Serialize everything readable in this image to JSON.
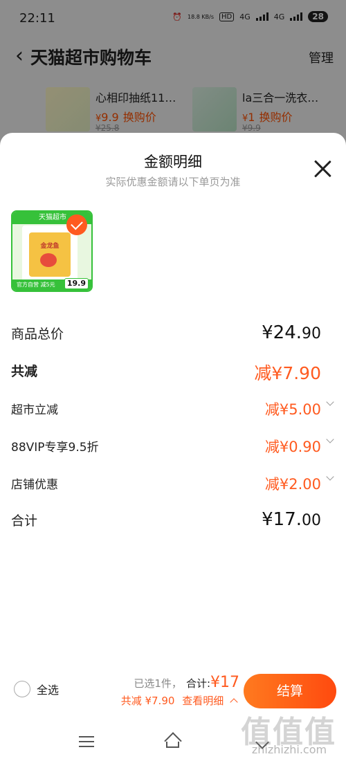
{
  "status_bar": {
    "time": "22:11",
    "net_speed": "18.8 KB/s",
    "hd": "HD",
    "net_type_1": "4G",
    "net_type_2": "4G",
    "battery": "28"
  },
  "header": {
    "back_icon": "chevron-left-icon",
    "title": "天猫超市购物车",
    "manage": "管理"
  },
  "promo_items": [
    {
      "name": "心相印抽纸11…",
      "price": "9.9",
      "tag": "换购价",
      "old_price": "¥25.8"
    },
    {
      "name": "la三合一洗衣…",
      "price": "1",
      "tag": "换购价",
      "old_price": "¥9.9"
    }
  ],
  "sheet": {
    "title": "金额明细",
    "subtitle": "实际优惠金额请以下单页为准",
    "close_icon": "close-icon"
  },
  "product": {
    "banner": "天猫超市",
    "name": "金龙鱼",
    "footer": "官方自营 减5元",
    "price_badge": "19.9",
    "selected": true
  },
  "breakdown": {
    "total_label": "商品总价",
    "total_yen": "¥24.",
    "total_dec": "90",
    "reduce_label": "共减",
    "reduce_value": "减¥7.90",
    "items": [
      {
        "label": "超市立减",
        "value": "减¥5.00"
      },
      {
        "label": "88VIP专享9.5折",
        "value": "减¥0.90"
      },
      {
        "label": "店铺优惠",
        "value": "减¥2.00"
      }
    ],
    "sum_label": "合计",
    "sum_yen": "¥17.",
    "sum_dec": "00"
  },
  "bottom_bar": {
    "select_all": "全选",
    "selected_count": "已选1件，",
    "total_label": "合计:",
    "total_value": "¥17",
    "discount_text": "共减 ¥7.90",
    "detail_link": "查看明细",
    "checkout": "结算"
  },
  "colors": {
    "accent": "#ff5a1f",
    "brand_green": "#36c13a"
  },
  "system_nav": [
    "menu-icon",
    "home-icon",
    "back-icon"
  ],
  "watermark": {
    "text": "zhizhizhi.com"
  }
}
